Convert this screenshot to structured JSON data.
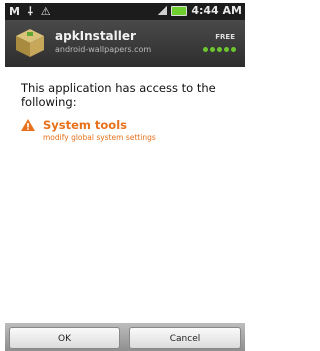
{
  "statusbar": {
    "left_icons": "M ⸸ ⚠",
    "time": "4:44 AM"
  },
  "header": {
    "app_name": "apkInstaller",
    "subtitle": "android-wallpapers.com",
    "badge": "FREE",
    "rating_dots": 5,
    "accent": "#6cc630"
  },
  "body": {
    "intro": "This application has access to the following:",
    "permissions": [
      {
        "title": "System tools",
        "description": "modify global system settings",
        "icon": "warning-icon",
        "color": "#e8711b"
      }
    ]
  },
  "buttons": {
    "ok_label": "OK",
    "cancel_label": "Cancel"
  }
}
